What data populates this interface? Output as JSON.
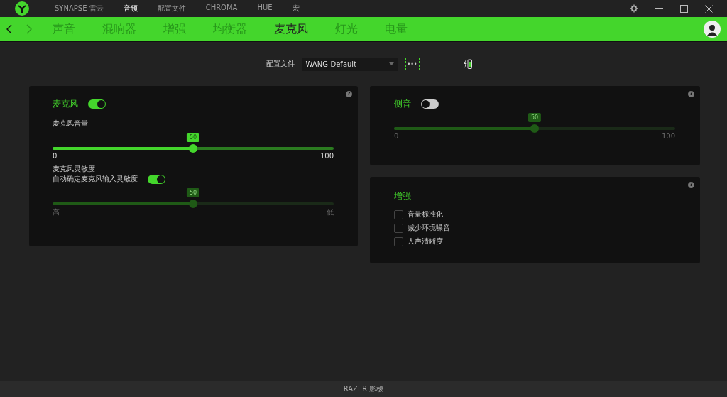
{
  "top_nav": {
    "items": [
      {
        "label": "SYNAPSE 雷云",
        "selected": false
      },
      {
        "label": "音频",
        "selected": true
      },
      {
        "label": "配置文件",
        "selected": false
      },
      {
        "label": "CHROMA",
        "selected": false
      },
      {
        "label": "HUE",
        "selected": false
      },
      {
        "label": "宏",
        "selected": false
      }
    ]
  },
  "sub_nav": {
    "tabs": [
      {
        "label": "声音",
        "selected": false
      },
      {
        "label": "混响器",
        "selected": false
      },
      {
        "label": "增强",
        "selected": false
      },
      {
        "label": "均衡器",
        "selected": false
      },
      {
        "label": "麦克风",
        "selected": true
      },
      {
        "label": "灯光",
        "selected": false
      },
      {
        "label": "电量",
        "selected": false
      }
    ]
  },
  "profile": {
    "label": "配置文件",
    "value": "WANG-Default",
    "more": "•••"
  },
  "mic_panel": {
    "help": "?",
    "title": "麦克风",
    "on": true,
    "volume": {
      "label": "麦克风音量",
      "value": "50",
      "level": 0.5,
      "disabled": false,
      "min": "0",
      "max": "100"
    },
    "sensitivity": {
      "label": "麦克风灵敏度",
      "auto_label": "自动确定麦克风输入灵敏度",
      "auto_on": true,
      "value": "50",
      "level": 0.5,
      "disabled": true,
      "min": "高",
      "max": "低"
    }
  },
  "sidetone_panel": {
    "help": "?",
    "title": "侧音",
    "on": false,
    "slider": {
      "value": "50",
      "level": 0.5,
      "disabled": true,
      "min": "0",
      "max": "100"
    }
  },
  "enhance_panel": {
    "help": "?",
    "title": "增强",
    "options": [
      {
        "label": "音量标准化",
        "checked": false
      },
      {
        "label": "减少环境噪音",
        "checked": false
      },
      {
        "label": "人声清晰度",
        "checked": false
      }
    ]
  },
  "status_bar": {
    "text": "RAZER 影梭"
  }
}
